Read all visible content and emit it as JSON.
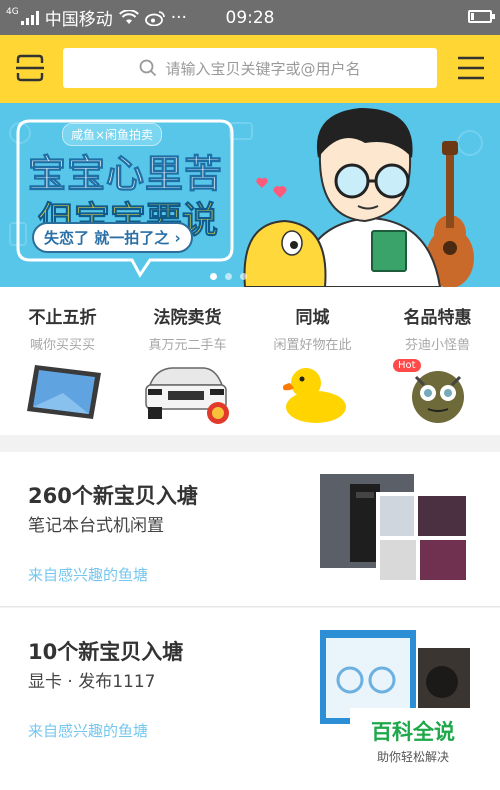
{
  "status_bar": {
    "network": "4G",
    "carrier": "中国移动",
    "time": "09:28",
    "more": "···"
  },
  "header": {
    "search_placeholder": "请输入宝贝关键字或@用户名",
    "scan_icon": "scan-icon",
    "menu_icon": "menu-icon",
    "accent": "#ffd634"
  },
  "banner": {
    "tag": "咸鱼×闲鱼拍卖",
    "line1": "宝宝心里苦",
    "line2": "但宝宝要说",
    "cta": "失恋了 就一拍了之 ›",
    "slides": 3,
    "active_slide": 1
  },
  "categories": [
    {
      "title": "不止五折",
      "subtitle": "喊你买买买",
      "image": "tablet"
    },
    {
      "title": "法院卖货",
      "subtitle": "真万元二手车",
      "image": "suv-car"
    },
    {
      "title": "同城",
      "subtitle": "闲置好物在此",
      "image": "rubber-duck"
    },
    {
      "title": "名品特惠",
      "subtitle": "芬迪小怪兽",
      "image": "fur-monster",
      "badge": "Hot"
    }
  ],
  "feed": [
    {
      "title": "260个新宝贝入塘",
      "subtitle": "笔记本台式机闲置",
      "source": "来自感兴趣的鱼塘"
    },
    {
      "title": "10个新宝贝入塘",
      "subtitle": "显卡 · 发布1117",
      "source": "来自感兴趣的鱼塘"
    }
  ],
  "watermark": {
    "title": "百科全说",
    "subtitle": "助你轻松解决"
  }
}
